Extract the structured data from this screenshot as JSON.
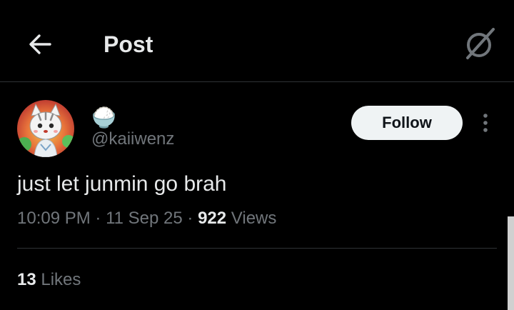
{
  "header": {
    "title": "Post",
    "back_icon": "arrow-left-icon",
    "grok_icon": "grok-icon"
  },
  "post": {
    "author": {
      "display_name": "🍚",
      "handle": "@kaiiwenz",
      "avatar_icon": "cat-avatar"
    },
    "follow_label": "Follow",
    "more_icon": "more-vertical-icon",
    "text": "just let junmin go brah",
    "time": "10:09 PM",
    "date": "11 Sep 25",
    "separator": "·",
    "views_count": "922",
    "views_label": "Views",
    "likes_count": "13",
    "likes_label": "Likes"
  },
  "colors": {
    "background": "#000000",
    "text_primary": "#e7e9ea",
    "text_secondary": "#71767b",
    "divider": "#2f3336",
    "follow_bg": "#eff3f4",
    "follow_text": "#0f1419"
  }
}
